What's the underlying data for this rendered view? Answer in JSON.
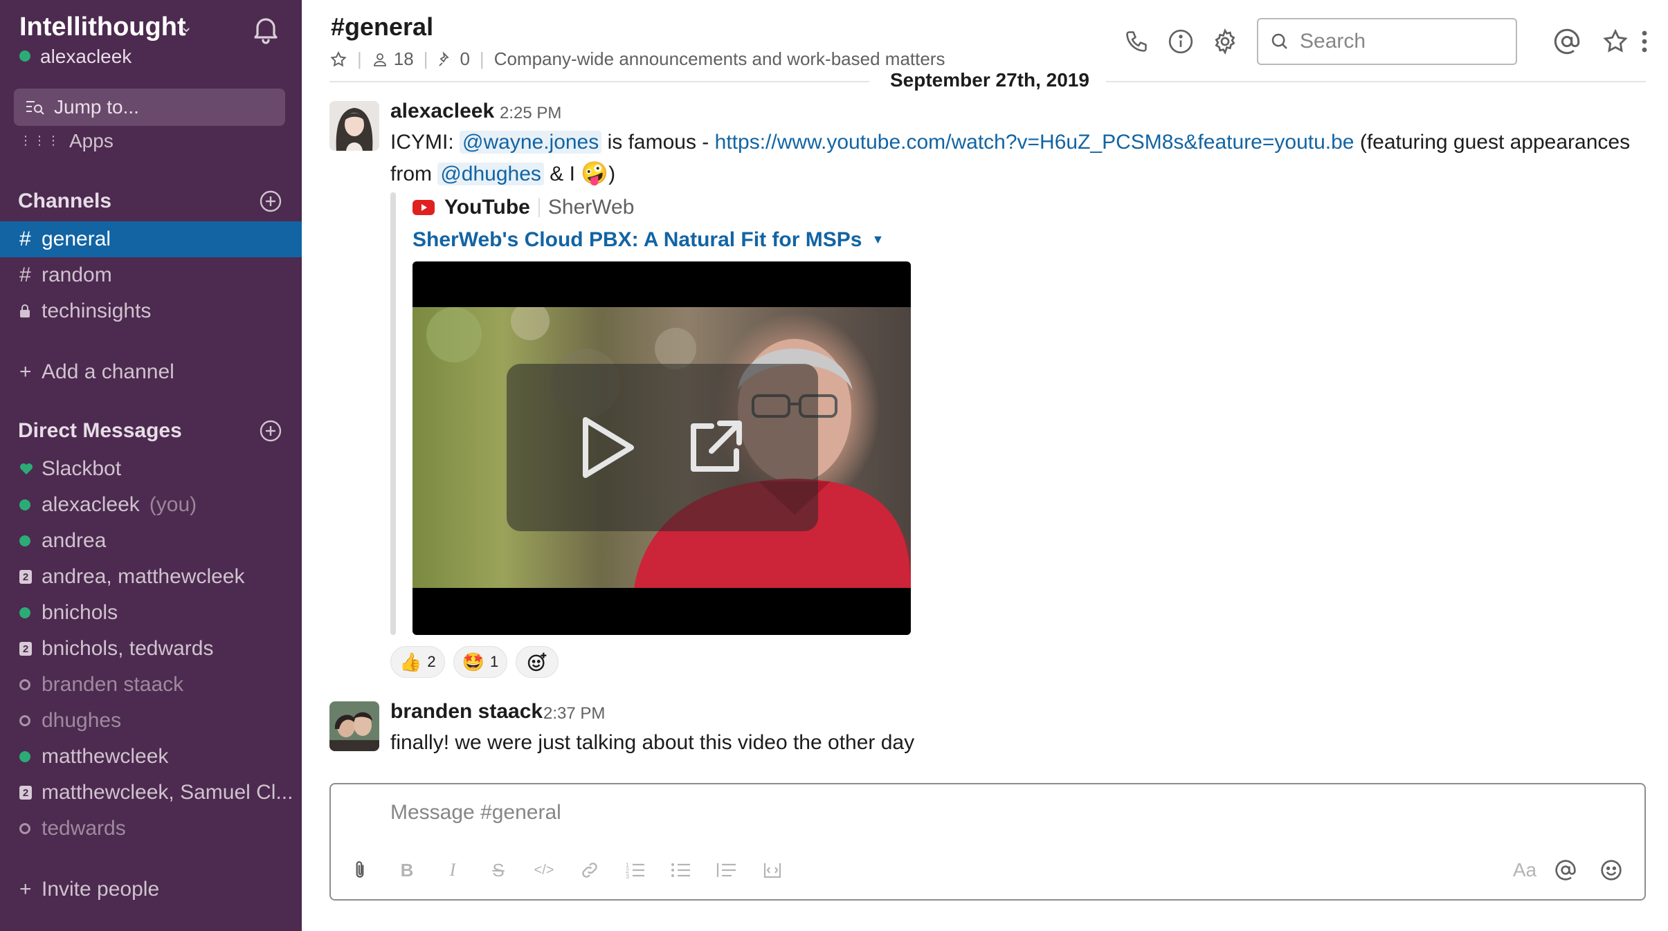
{
  "workspace": {
    "name": "Intellithought",
    "user": "alexacleek"
  },
  "sidebar": {
    "jump_label": "Jump to...",
    "apps_label": "Apps",
    "channels_heading": "Channels",
    "channels": [
      {
        "prefix": "#",
        "label": "general",
        "active": true
      },
      {
        "prefix": "#",
        "label": "random"
      },
      {
        "prefix": "lock",
        "label": "techinsights"
      }
    ],
    "add_channel_label": "Add a channel",
    "dm_heading": "Direct Messages",
    "dms": [
      {
        "label": "Slackbot",
        "status": "heart"
      },
      {
        "label": "alexacleek",
        "suffix": "(you)",
        "status": "online"
      },
      {
        "label": "andrea",
        "status": "online"
      },
      {
        "label": "andrea, matthewcleek",
        "status": "group",
        "count": "2"
      },
      {
        "label": "bnichols",
        "status": "online"
      },
      {
        "label": "bnichols, tedwards",
        "status": "group",
        "count": "2"
      },
      {
        "label": "branden staack",
        "status": "away"
      },
      {
        "label": "dhughes",
        "status": "away"
      },
      {
        "label": "matthewcleek",
        "status": "online"
      },
      {
        "label": "matthewcleek, Samuel Cl...",
        "status": "group",
        "count": "2"
      },
      {
        "label": "tedwards",
        "status": "away"
      }
    ],
    "invite_label": "Invite people"
  },
  "header": {
    "channel": "#general",
    "members": "18",
    "pins": "0",
    "topic": "Company-wide announcements and work-based matters",
    "search_placeholder": "Search"
  },
  "date_divider": "September 27th, 2019",
  "messages": [
    {
      "author": "alexacleek",
      "time": "2:25 PM",
      "text_pre": "ICYMI:",
      "mention1": "@wayne.jones",
      "text_mid": "is famous -",
      "link": "https://www.youtube.com/watch?v=H6uZ_PCSM8s&feature=youtu.be",
      "text_post": "(featuring guest appearances",
      "line2_pre": "from",
      "mention2": "@dhughes",
      "line2_post": "& I",
      "line2_end": ")",
      "attachment": {
        "service": "YouTube",
        "author": "SherWeb",
        "title": "SherWeb's Cloud PBX: A Natural Fit for MSPs"
      },
      "reactions": [
        {
          "emoji": "👍",
          "count": "2"
        },
        {
          "emoji": "🤩",
          "count": "1"
        }
      ]
    },
    {
      "author": "branden staack",
      "time": "2:37 PM",
      "text": "finally! we were just talking about this video the other day"
    }
  ],
  "composer": {
    "placeholder": "Message #general",
    "format_label": "Aa"
  },
  "colors": {
    "sidebar_bg": "#4d2a4f",
    "active_channel": "#1264a3",
    "presence_online": "#2bac76",
    "link": "#1264a3"
  }
}
